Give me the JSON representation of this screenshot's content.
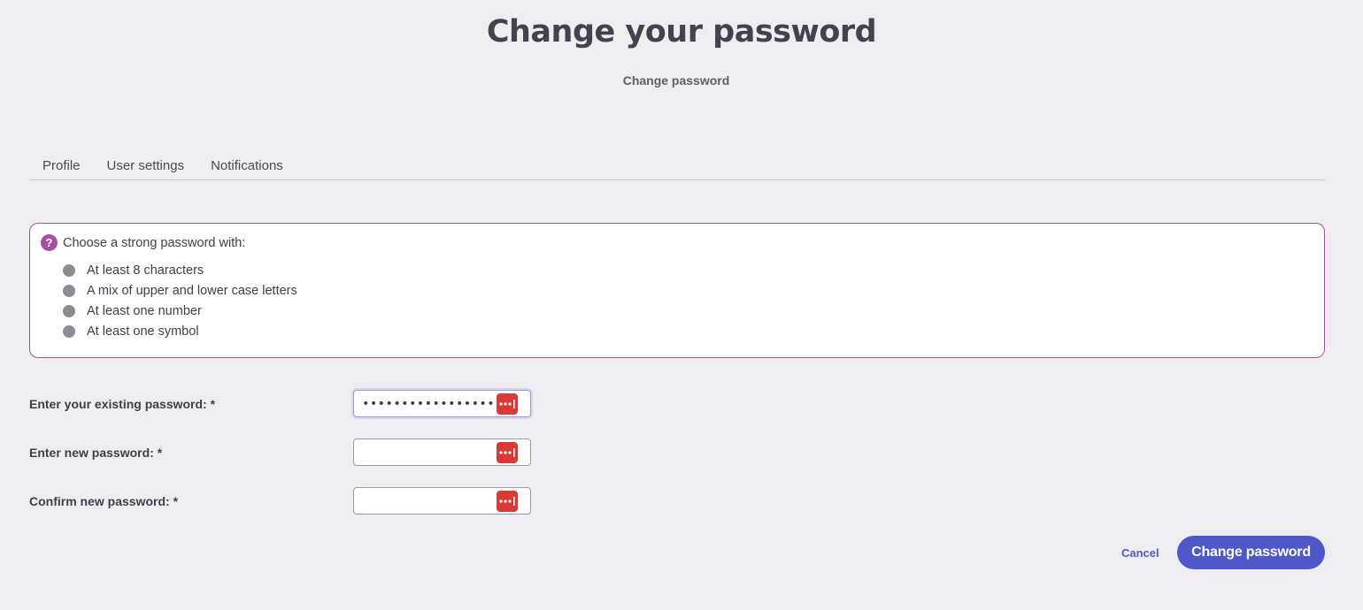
{
  "header": {
    "title": "Change your password",
    "breadcrumb": "Change password"
  },
  "tabs": [
    {
      "label": "Profile"
    },
    {
      "label": "User settings"
    },
    {
      "label": "Notifications"
    }
  ],
  "hint": {
    "icon": "question-icon",
    "title": "Choose a strong password with:",
    "items": [
      "At least 8 characters",
      "A mix of upper and lower case letters",
      "At least one number",
      "At least one symbol"
    ]
  },
  "form": {
    "existing": {
      "label": "Enter your existing password: *",
      "value": "•••••••••••••••••••",
      "icon": "password-manager-icon"
    },
    "new": {
      "label": "Enter new password: *",
      "value": "",
      "icon": "password-manager-icon"
    },
    "confirm": {
      "label": "Confirm new password: *",
      "value": "",
      "icon": "password-manager-icon"
    }
  },
  "actions": {
    "cancel": "Cancel",
    "submit": "Change password"
  },
  "colors": {
    "accent": "#5057c8",
    "hint_border": "#a64ea0",
    "password_manager": "#d93a33",
    "background": "#eeeef1"
  }
}
